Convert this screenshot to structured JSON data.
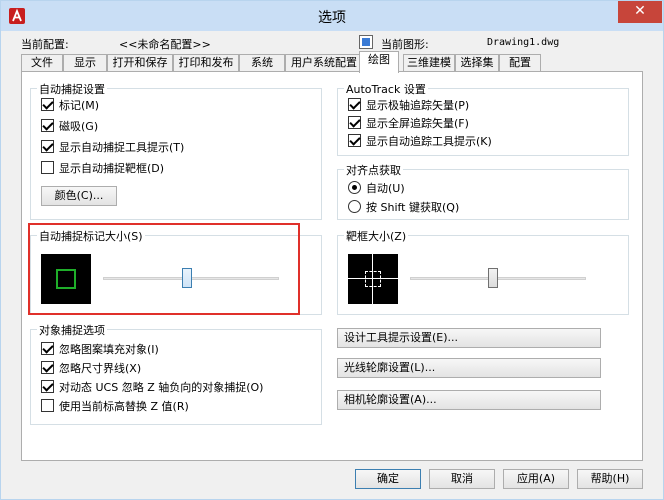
{
  "window": {
    "title": "选项",
    "close_glyph": "✕"
  },
  "profile": {
    "current_config_label": "当前配置:",
    "current_config_value": "<<未命名配置>>",
    "current_drawing_label": "当前图形:",
    "current_drawing_value": "Drawing1.dwg"
  },
  "tabs": [
    {
      "label": "文件"
    },
    {
      "label": "显示"
    },
    {
      "label": "打开和保存"
    },
    {
      "label": "打印和发布"
    },
    {
      "label": "系统"
    },
    {
      "label": "用户系统配置"
    },
    {
      "label": "绘图"
    },
    {
      "label": "三维建模"
    },
    {
      "label": "选择集"
    },
    {
      "label": "配置"
    }
  ],
  "active_tab": "绘图",
  "autosnap": {
    "title": "自动捕捉设置",
    "items": [
      {
        "label": "标记(M)",
        "checked": true
      },
      {
        "label": "磁吸(G)",
        "checked": true
      },
      {
        "label": "显示自动捕捉工具提示(T)",
        "checked": true
      },
      {
        "label": "显示自动捕捉靶框(D)",
        "checked": false
      }
    ],
    "color_button": "颜色(C)..."
  },
  "autotrack": {
    "title": "AutoTrack 设置",
    "items": [
      {
        "label": "显示极轴追踪矢量(P)",
        "checked": true
      },
      {
        "label": "显示全屏追踪矢量(F)",
        "checked": true
      },
      {
        "label": "显示自动追踪工具提示(K)",
        "checked": true
      }
    ]
  },
  "alignment": {
    "title": "对齐点获取",
    "options": [
      {
        "label": "自动(U)",
        "checked": true
      },
      {
        "label": "按 Shift 键获取(Q)",
        "checked": false
      }
    ]
  },
  "marker_size": {
    "title": "自动捕捉标记大小(S)",
    "slider_fraction": 0.47,
    "marker_color": "#1fae2a"
  },
  "aperture_size": {
    "title": "靶框大小(Z)",
    "slider_fraction": 0.47
  },
  "osnap": {
    "title": "对象捕捉选项",
    "items": [
      {
        "label": "忽略图案填充对象(I)",
        "checked": true
      },
      {
        "label": "忽略尺寸界线(X)",
        "checked": true
      },
      {
        "label": "对动态 UCS 忽略 Z 轴负向的对象捕捉(O)",
        "checked": true
      },
      {
        "label": "使用当前标高替换 Z 值(R)",
        "checked": false
      }
    ]
  },
  "right_buttons": [
    {
      "label": "设计工具提示设置(E)..."
    },
    {
      "label": "光线轮廓设置(L)..."
    },
    {
      "label": "相机轮廓设置(A)..."
    }
  ],
  "footer": {
    "ok": "确定",
    "cancel": "取消",
    "apply": "应用(A)",
    "help": "帮助(H)"
  },
  "colors": {
    "titlebar": "#c9def5",
    "close": "#c7453a",
    "highlight": "#e0302a",
    "app_icon": "#c81e1e"
  }
}
